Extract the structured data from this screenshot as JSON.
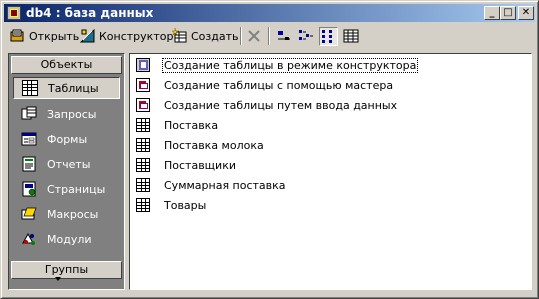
{
  "window": {
    "title": "db4 : база данных"
  },
  "titlebar_buttons": {
    "minimize": "_",
    "maximize": "□",
    "close": "✕"
  },
  "toolbar": {
    "open_label": "Открыть",
    "design_label": "Конструктор",
    "create_label": "Создать"
  },
  "sidebar": {
    "header": "Объекты",
    "footer": "Группы",
    "items": [
      {
        "label": "Таблицы",
        "icon": "table-icon",
        "active": true
      },
      {
        "label": "Запросы",
        "icon": "query-icon",
        "active": false
      },
      {
        "label": "Формы",
        "icon": "form-icon",
        "active": false
      },
      {
        "label": "Отчеты",
        "icon": "report-icon",
        "active": false
      },
      {
        "label": "Страницы",
        "icon": "page-icon",
        "active": false
      },
      {
        "label": "Макросы",
        "icon": "macro-icon",
        "active": false
      },
      {
        "label": "Модули",
        "icon": "module-icon",
        "active": false
      }
    ]
  },
  "list": {
    "items": [
      {
        "label": "Создание таблицы в режиме конструктора",
        "icon": "design-wizard-icon",
        "selected": true
      },
      {
        "label": "Создание таблицы с помощью мастера",
        "icon": "wizard-icon",
        "selected": false
      },
      {
        "label": "Создание таблицы путем ввода данных",
        "icon": "wizard-icon",
        "selected": false
      },
      {
        "label": "Поставка",
        "icon": "table-icon",
        "selected": false
      },
      {
        "label": "Поставка молока",
        "icon": "table-icon",
        "selected": false
      },
      {
        "label": "Поставщики",
        "icon": "table-icon",
        "selected": false
      },
      {
        "label": "Суммарная поставка",
        "icon": "table-icon",
        "selected": false
      },
      {
        "label": "Товары",
        "icon": "table-icon",
        "selected": false
      }
    ]
  }
}
